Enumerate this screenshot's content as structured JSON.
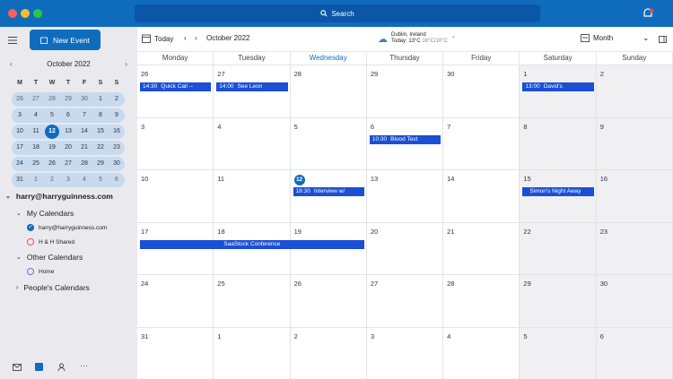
{
  "titlebar": {
    "search_label": "Search",
    "badge_color": "#e74c3c"
  },
  "sidebar": {
    "new_event": "New Event",
    "mini_month": "October 2022",
    "weekdays": [
      "M",
      "T",
      "W",
      "T",
      "F",
      "S",
      "S"
    ],
    "weeks": [
      [
        "26",
        "27",
        "28",
        "29",
        "30",
        "1",
        "2"
      ],
      [
        "3",
        "4",
        "5",
        "6",
        "7",
        "8",
        "9"
      ],
      [
        "10",
        "11",
        "12",
        "13",
        "14",
        "15",
        "16"
      ],
      [
        "17",
        "18",
        "19",
        "20",
        "21",
        "22",
        "23"
      ],
      [
        "24",
        "25",
        "26",
        "27",
        "28",
        "29",
        "30"
      ],
      [
        "31",
        "1",
        "2",
        "3",
        "4",
        "5",
        "6"
      ]
    ],
    "account": "harry@harryguinness.com",
    "my_calendars": "My Calendars",
    "cal_items": [
      {
        "label": "harry@harryguinness.com",
        "color": "#0f6cbd",
        "checked": true
      },
      {
        "label": "H & H Shared",
        "color": "#e05a43",
        "checked": false
      }
    ],
    "other_calendars": "Other Calendars",
    "other_items": [
      {
        "label": "Home",
        "color": "#8a63d2"
      }
    ],
    "people_calendars": "People's Calendars"
  },
  "toolbar": {
    "today": "Today",
    "month_label": "October 2022",
    "weather_city": "Dublin, Ireland",
    "weather_temp": "Today: 13°C",
    "weather_range": "16°C/10°C",
    "view": "Month"
  },
  "days": [
    "Monday",
    "Tuesday",
    "Wednesday",
    "Thursday",
    "Friday",
    "Saturday",
    "Sunday"
  ],
  "weeks": [
    [
      "26",
      "27",
      "28",
      "29",
      "30",
      "1",
      "2"
    ],
    [
      "3",
      "4",
      "5",
      "6",
      "7",
      "8",
      "9"
    ],
    [
      "10",
      "11",
      "12",
      "13",
      "14",
      "15",
      "16"
    ],
    [
      "17",
      "18",
      "19",
      "20",
      "21",
      "22",
      "23"
    ],
    [
      "24",
      "25",
      "26",
      "27",
      "28",
      "29",
      "30"
    ],
    [
      "31",
      "1",
      "2",
      "3",
      "4",
      "5",
      "6"
    ]
  ],
  "events": {
    "e1": {
      "time": "14:30",
      "title": "Quick Call -- "
    },
    "e2": {
      "time": "14:00",
      "title": "See Leon"
    },
    "e3": {
      "time": "13:00",
      "title": "David's"
    },
    "e4": {
      "time": "10:30",
      "title": "Blood Test"
    },
    "e5": {
      "time": "18:30",
      "title": "Interview w/"
    },
    "e6": {
      "time": "",
      "title": "Simon's Night Away"
    },
    "e7": {
      "time": "",
      "title": "SaaStock Conference"
    }
  }
}
